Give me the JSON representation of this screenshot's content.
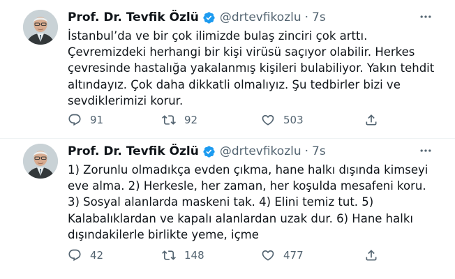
{
  "tweets": [
    {
      "author": {
        "name": "Prof. Dr. Tevfik Özlü",
        "handle": "@drtevfikozlu",
        "separator": "·",
        "time": "7s"
      },
      "text": "İstanbul’da ve bir çok ilimizde bulaş zinciri çok arttı. Çevremizdeki herhangi bir kişi virüsü saçıyor olabilir. Herkes çevresinde hastalığa yakalanmış kişileri bulabiliyor. Yakın tehdit altındayız. Çok daha dikkatli olmalıyız. Şu tedbirler bizi ve sevdiklerimizi korur.",
      "counts": {
        "replies": "91",
        "retweets": "92",
        "likes": "503"
      }
    },
    {
      "author": {
        "name": "Prof. Dr. Tevfik Özlü",
        "handle": "@drtevfikozlu",
        "separator": "·",
        "time": "7s"
      },
      "text": "1) Zorunlu olmadıkça evden çıkma, hane halkı dışında kimseyi eve alma. 2) Herkesle, her zaman, her koşulda mesafeni koru. 3) Sosyal alanlarda maskeni tak. 4) Elini temiz tut. 5) Kalabalıklardan ve kapalı alanlardan uzak dur. 6) Hane halkı dışındakilerle birlikte yeme, içme",
      "counts": {
        "replies": "42",
        "retweets": "148",
        "likes": "477"
      }
    }
  ],
  "colors": {
    "text": "#0f1419",
    "secondary": "#536471",
    "verified": "#1d9bf0",
    "divider": "#eff3f4"
  },
  "icons": {
    "verified": "verified-badge-icon",
    "more": "more-options-icon",
    "reply": "reply-icon",
    "retweet": "retweet-icon",
    "like": "like-icon",
    "share": "share-icon"
  }
}
